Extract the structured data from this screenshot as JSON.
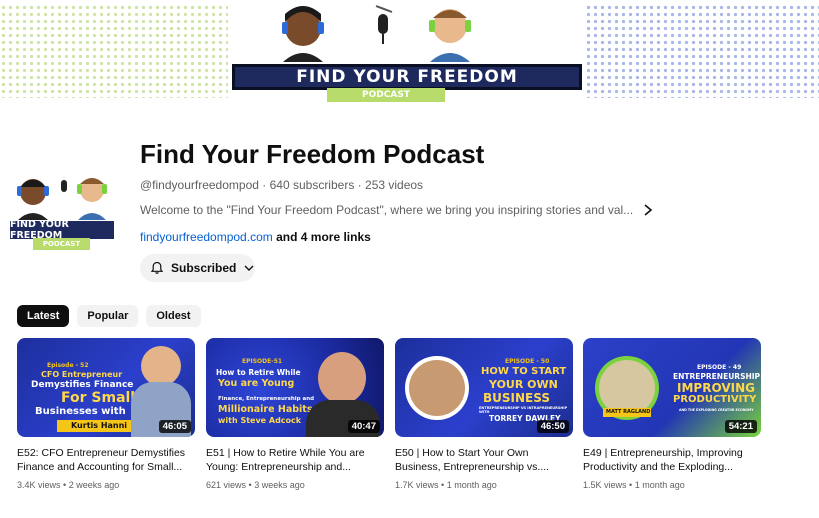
{
  "banner": {
    "title": "FIND YOUR FREEDOM",
    "subtitle": "PODCAST"
  },
  "avatar": {
    "title": "FIND YOUR FREEDOM",
    "subtitle": "PODCAST"
  },
  "channel": {
    "name": "Find Your Freedom Podcast",
    "handle": "@findyourfreedompod",
    "subscribers": "640 subscribers",
    "videos": "253 videos",
    "description": "Welcome to the \"Find Your Freedom Podcast\", where we bring you inspiring stories and val...",
    "link": "findyourfreedompod.com",
    "more_links": "and 4 more links",
    "subscribe_label": "Subscribed"
  },
  "chips": [
    "Latest",
    "Popular",
    "Oldest"
  ],
  "videos": [
    {
      "title": "E52: CFO Entrepreneur Demystifies Finance and Accounting for Small...",
      "views": "3.4K views",
      "age": "2 weeks ago",
      "duration": "46:05",
      "thumb_ep": "Episode - 52",
      "thumb_line1": "CFO Entrepreneur",
      "thumb_line2": "Demystifies Finance",
      "thumb_line3": "For Small",
      "thumb_line4": "Businesses with",
      "thumb_name": "Kurtis Hanni"
    },
    {
      "title": "E51 | How to Retire While You are Young: Entrepreneurship and...",
      "views": "621 views",
      "age": "3 weeks ago",
      "duration": "40:47",
      "thumb_ep": "EPISODE-51",
      "thumb_line1": "How to Retire While",
      "thumb_line2": "You are Young",
      "thumb_line3": "Finance, Entrepreneurship and",
      "thumb_line4": "Millionaire Habits",
      "thumb_name": "with Steve Adcock"
    },
    {
      "title": "E50 | How to Start Your Own Business, Entrepreneurship vs....",
      "views": "1.7K views",
      "age": "1 month ago",
      "duration": "46:50",
      "thumb_ep": "EPISODE - 50",
      "thumb_line1": "HOW TO START",
      "thumb_line2": "YOUR OWN",
      "thumb_line3": "BUSINESS",
      "thumb_line4": "ENTREPRENEURSHIP VS INTRAPRENEURSHIP WITH",
      "thumb_name": "TORREY DAWLEY"
    },
    {
      "title": "E49 | Entrepreneurship, Improving Productivity and the Exploding...",
      "views": "1.5K views",
      "age": "1 month ago",
      "duration": "54:21",
      "thumb_ep": "EPISODE - 49",
      "thumb_line1": "ENTREPRENEURSHIP",
      "thumb_line2": "IMPROVING",
      "thumb_line3": "PRODUCTIVITY",
      "thumb_line4": "AND THE EXPLODING CREATOR ECONOMY",
      "thumb_name": "MATT RAGLAND"
    }
  ],
  "colors": {
    "accent": "#065fd4",
    "banner_navy": "#1e2a5e",
    "banner_green": "#b7dc6c"
  }
}
